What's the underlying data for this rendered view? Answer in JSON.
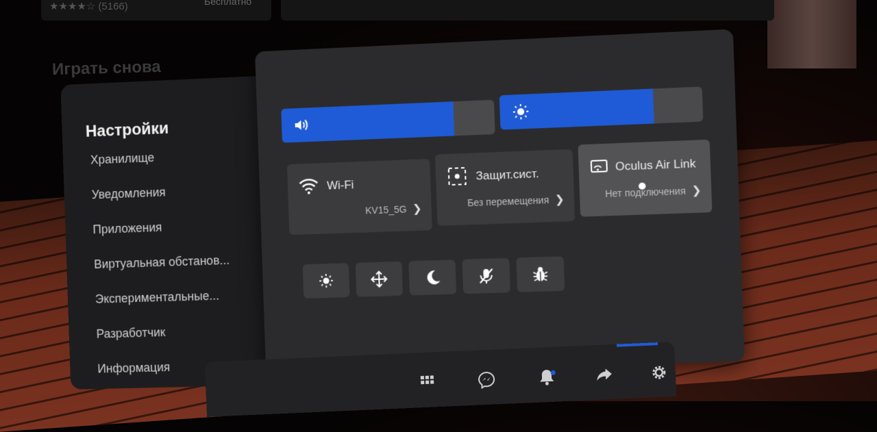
{
  "background": {
    "store_rating": "★★★★☆ (5166)",
    "store_price": "Бесплатно",
    "section_heading": "Играть снова"
  },
  "sidebar": {
    "title": "Настройки",
    "items": [
      {
        "label": "Хранилище"
      },
      {
        "label": "Уведомления"
      },
      {
        "label": "Приложения"
      },
      {
        "label": "Виртуальная обстанов..."
      },
      {
        "label": "Экспериментальные..."
      },
      {
        "label": "Разработчик"
      },
      {
        "label": "Информация"
      }
    ]
  },
  "sliders": {
    "volume": {
      "icon": "volume-icon",
      "value_percent": 81
    },
    "brightness": {
      "icon": "brightness-icon",
      "value_percent": 76
    }
  },
  "tiles": {
    "wifi": {
      "title": "Wi-Fi",
      "subtitle": "KV15_5G",
      "icon": "wifi-icon"
    },
    "guardian": {
      "title": "Защит.сист.",
      "subtitle": "Без перемещения",
      "icon": "guardian-icon"
    },
    "air_link": {
      "title": "Oculus Air Link",
      "subtitle": "Нет подключения",
      "icon": "air-link-icon"
    }
  },
  "quick_actions": [
    {
      "icon": "brightness-small-icon"
    },
    {
      "icon": "move-icon"
    },
    {
      "icon": "night-mode-icon"
    },
    {
      "icon": "mic-muted-icon"
    },
    {
      "icon": "bug-report-icon"
    }
  ],
  "dock": {
    "icons": [
      "apps-icon",
      "messenger-icon",
      "notifications-icon",
      "share-icon",
      "settings-icon"
    ]
  },
  "colors": {
    "accent": "#1f5bd6",
    "panel": "#2b2b2d",
    "sidebar": "#1d1d1f",
    "tile": "#3b3b3d"
  }
}
